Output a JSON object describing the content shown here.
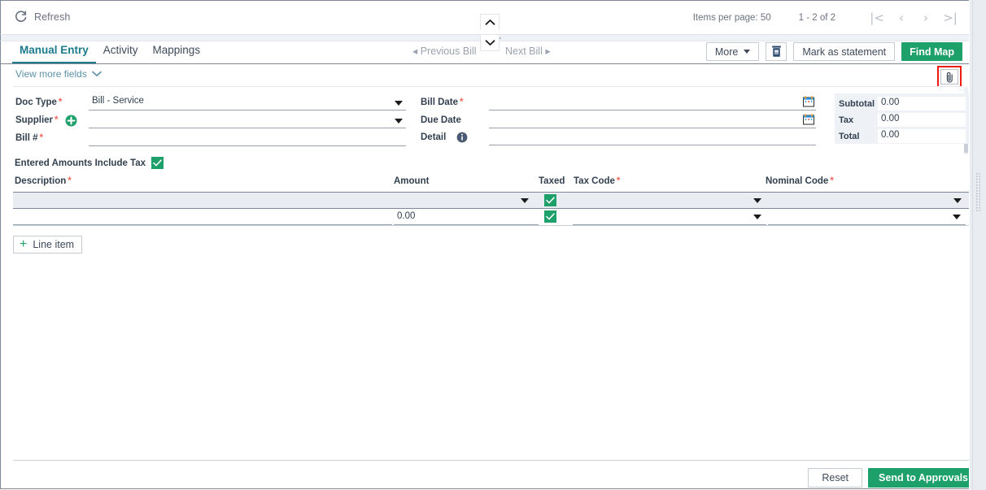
{
  "topbar": {
    "refresh_label": "Refresh",
    "refresh_icon": "refresh-icon",
    "items_per_page_label": "Items per page:",
    "items_per_page_value": "50",
    "range_label": "1 - 2 of 2",
    "first_page_icon": "|<",
    "prev_page_icon": "‹",
    "next_page_icon": "›",
    "last_page_icon": ">|"
  },
  "tabs": [
    {
      "label": "Manual Entry",
      "active": true
    },
    {
      "label": "Activity",
      "active": false
    },
    {
      "label": "Mappings",
      "active": false
    }
  ],
  "record_nav": {
    "previous_label": "◂ Previous Bill",
    "next_label": "Next Bill ▸"
  },
  "toolbar": {
    "more_label": "More",
    "delete_icon": "trash-icon",
    "mark_as_statement_label": "Mark as statement",
    "find_map_label": "Find Map"
  },
  "subheader": {
    "view_more_fields_label": "View more fields",
    "chevron_icon": "chevron-down-icon",
    "attachment_icon": "paperclip-icon",
    "attachment_highlight_color": "#ee1b11"
  },
  "form": {
    "left_fields": [
      {
        "label": "Doc Type",
        "required": true,
        "value": "Bill - Service",
        "control": "dropdown"
      },
      {
        "label": "Supplier",
        "required": true,
        "value": "",
        "control": "dropdown",
        "adornment": "add-circle-icon"
      },
      {
        "label": "Bill #",
        "required": true,
        "value": "",
        "control": "text"
      }
    ],
    "right_fields": [
      {
        "label": "Bill Date",
        "required": true,
        "value": "",
        "control": "date",
        "adornment": "calendar-icon"
      },
      {
        "label": "Due Date",
        "required": false,
        "value": "",
        "control": "date",
        "adornment": "calendar-icon"
      },
      {
        "label": "Detail",
        "required": false,
        "value": "",
        "control": "text",
        "adornment": "info-icon"
      }
    ]
  },
  "totals": [
    {
      "label": "Subtotal",
      "value": "0.00"
    },
    {
      "label": "Tax",
      "value": "0.00"
    },
    {
      "label": "Total",
      "value": "0.00"
    }
  ],
  "include_tax": {
    "label": "Entered Amounts Include Tax",
    "checked": true,
    "check_color": "#1ea06a"
  },
  "grid": {
    "columns": [
      {
        "label": "Description",
        "required": true
      },
      {
        "label": "Amount",
        "required": false
      },
      {
        "label": "Taxed",
        "required": false
      },
      {
        "label": "Tax Code",
        "required": true
      },
      {
        "label": "Nominal Code",
        "required": true
      }
    ],
    "filter_row": {
      "description": "",
      "amount": "",
      "taxed_checked": true,
      "tax_code": "",
      "nominal_code": ""
    },
    "rows": [
      {
        "description": "",
        "amount": "0.00",
        "taxed_checked": true,
        "tax_code": "",
        "nominal_code": ""
      }
    ],
    "add_line_label": "Line item",
    "add_line_icon": "plus-icon"
  },
  "footer": {
    "reset_label": "Reset",
    "send_label": "Send to Approvals"
  },
  "colors": {
    "accent_green": "#1ea06a",
    "active_tab": "#1c7b8c",
    "required_star": "#f4665c",
    "highlight": "#ee1b11"
  }
}
